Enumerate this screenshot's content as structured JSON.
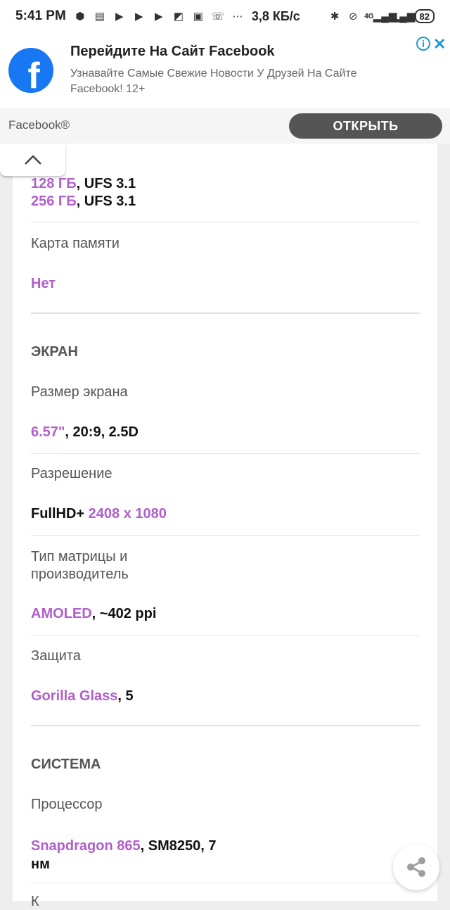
{
  "status_bar": {
    "time": "5:41 PM",
    "speed": "3,8 КБ/с",
    "network": "4G",
    "battery": "82"
  },
  "ad": {
    "title": "Перейдите На Сайт Facebook",
    "description": "Узнавайте Самые Свежие Новости У Друзей На Сайте Facebook! 12+",
    "brand": "Facebook®",
    "open_button": "ОТКРЫТЬ",
    "logo_letter": "f",
    "brand_color": "#1877f2"
  },
  "storage": {
    "option1_size": "128 ГБ",
    "option1_type": ", UFS 3.1",
    "option2_size": "256 ГБ",
    "option2_type": ", UFS 3.1"
  },
  "memory_card": {
    "label": "Карта памяти",
    "value": "Нет"
  },
  "screen": {
    "heading": "ЭКРАН",
    "size_label": "Размер экрана",
    "size_value": "6.57\"",
    "size_extra": ", 20:9, 2.5D",
    "resolution_label": "Разрешение",
    "resolution_prefix": "FullHD+ ",
    "resolution_value": "2408 x 1080",
    "matrix_label_line1": "Тип матрицы и",
    "matrix_label_line2": "производитель",
    "matrix_value": "AMOLED",
    "matrix_extra": ", ~402 ppi",
    "protection_label": "Защита",
    "protection_value": "Gorilla Glass",
    "protection_extra": ", 5"
  },
  "system": {
    "heading": "СИСТЕМА",
    "cpu_label": "Процессор",
    "cpu_value": "Snapdragon 865",
    "cpu_extra_line1": ", SM8250, 7",
    "cpu_extra_line2": "нм",
    "next_label_partial": "К"
  },
  "colors": {
    "accent": "#b05fcc",
    "button": "#555555",
    "info_icon": "#1a9bd6"
  }
}
